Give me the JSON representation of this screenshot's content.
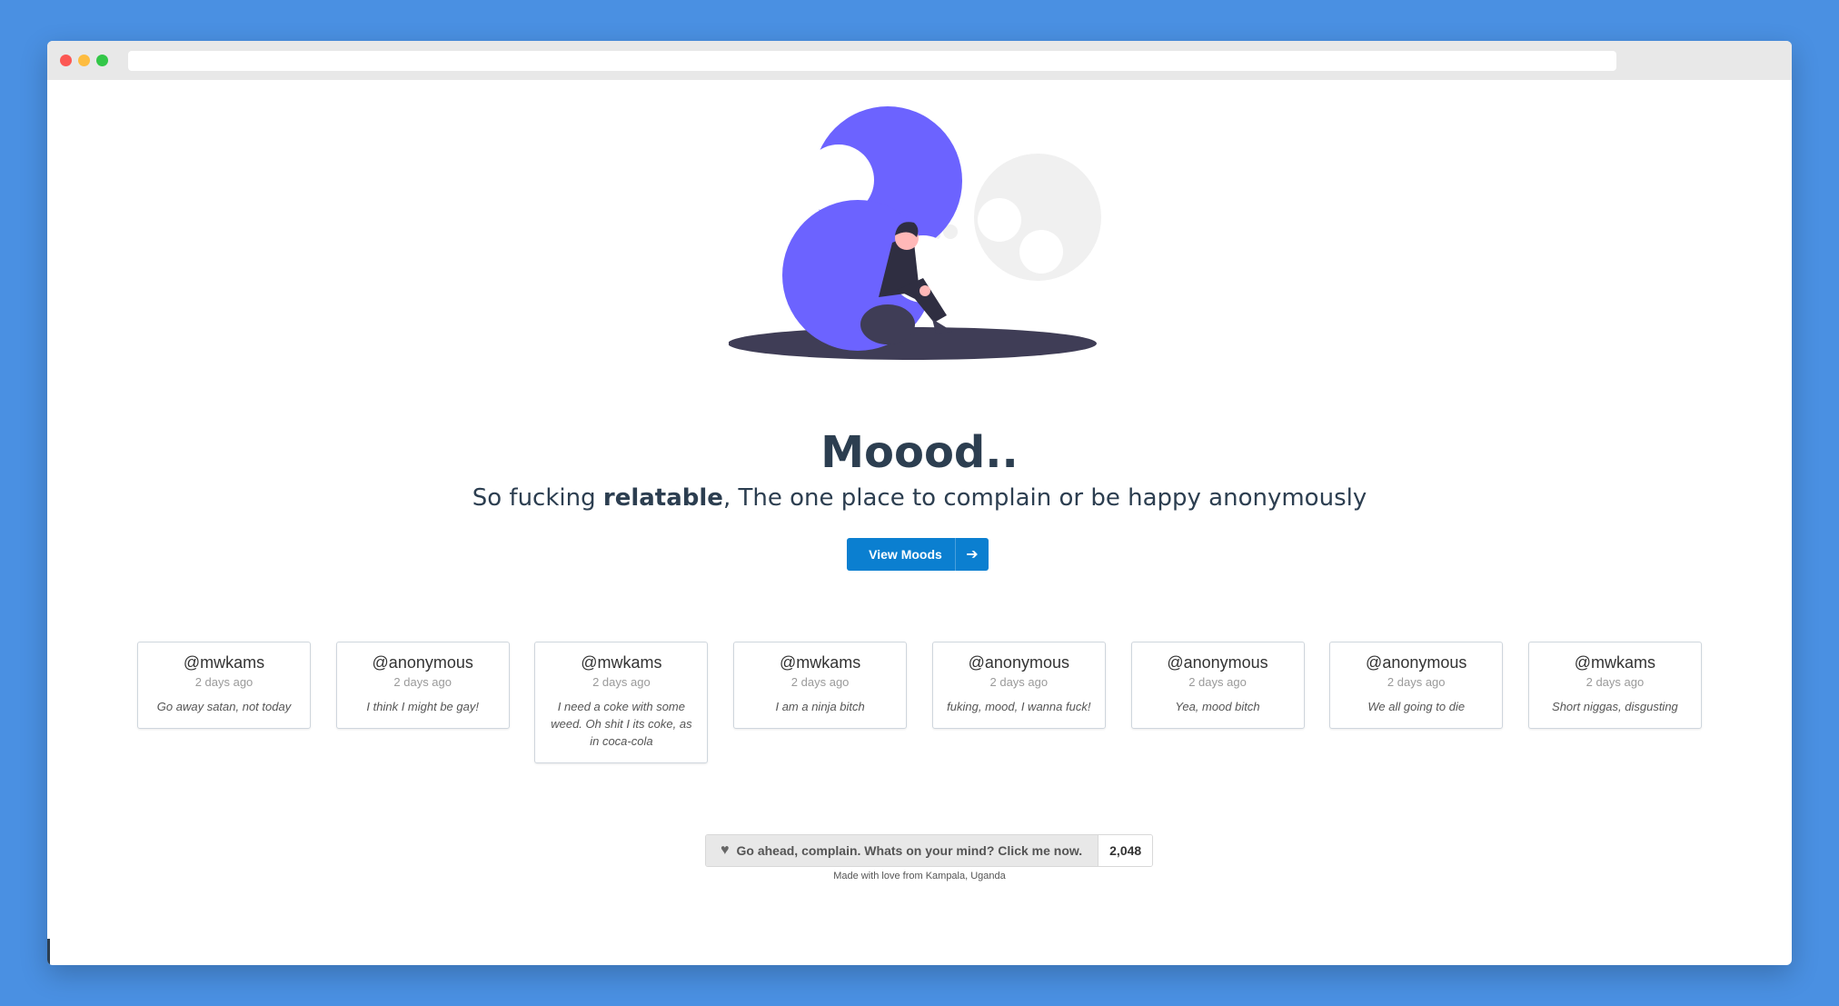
{
  "hero": {
    "title": "Moood..",
    "tagline_prefix": "So fucking ",
    "tagline_bold": "relatable",
    "tagline_suffix": ", The one place to complain or be happy anonymously",
    "cta_label": "View Moods"
  },
  "moods": [
    {
      "user": "@mwkams",
      "time": "2 days ago",
      "text": "Go away satan, not today"
    },
    {
      "user": "@anonymous",
      "time": "2 days ago",
      "text": "I think I might be gay!"
    },
    {
      "user": "@mwkams",
      "time": "2 days ago",
      "text": "I need a coke with some weed. Oh shit I its coke, as in coca-cola"
    },
    {
      "user": "@mwkams",
      "time": "2 days ago",
      "text": "I am a ninja bitch"
    },
    {
      "user": "@anonymous",
      "time": "2 days ago",
      "text": "fuking, mood, I wanna fuck!"
    },
    {
      "user": "@anonymous",
      "time": "2 days ago",
      "text": "Yea, mood bitch"
    },
    {
      "user": "@anonymous",
      "time": "2 days ago",
      "text": "We all going to die"
    },
    {
      "user": "@mwkams",
      "time": "2 days ago",
      "text": "Short niggas, disgusting"
    }
  ],
  "complain": {
    "label": "Go ahead, complain. Whats on your mind? Click me now.",
    "count": "2,048"
  },
  "footer": {
    "text": "Made with love from Kampala, Uganda"
  },
  "colors": {
    "background": "#4a90e2",
    "accent": "#0b7fd0",
    "illustration_purple": "#6c63ff",
    "title": "#2c3e50"
  },
  "icons": {
    "cta": "arrow-right-icon",
    "complain": "heart-icon"
  }
}
